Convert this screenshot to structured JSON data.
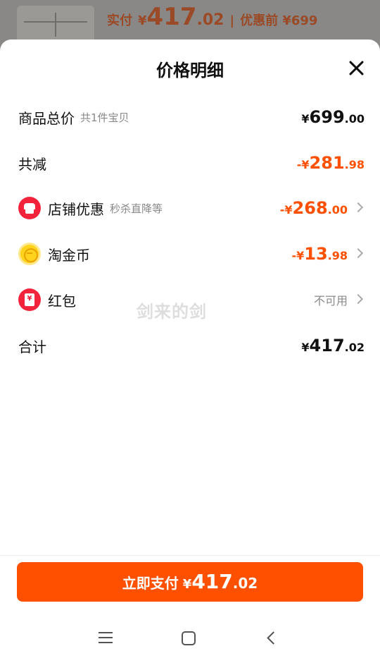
{
  "background": {
    "price_label": "实付",
    "yen": "¥",
    "price_int": "417",
    "price_dec": ".02",
    "separator": "|",
    "original_label": "优惠前 ¥699"
  },
  "sheet": {
    "title": "价格明细",
    "close_icon": "close-icon"
  },
  "rows": {
    "total": {
      "label": "商品总价",
      "sub": "共1件宝贝",
      "yen": "¥",
      "int": "699",
      "dec": ".00"
    },
    "reduce": {
      "label": "共减",
      "yen": "-¥",
      "int": "281",
      "dec": ".98"
    },
    "shop": {
      "label": "店铺优惠",
      "sub": "秒杀直降等",
      "yen": "-¥",
      "int": "268",
      "dec": ".00",
      "icon": "shop-icon"
    },
    "coin": {
      "label": "淘金币",
      "yen": "-¥",
      "int": "13",
      "dec": ".98",
      "icon": "gold-coin-icon"
    },
    "redpack": {
      "label": "红包",
      "status": "不可用",
      "icon": "red-envelope-icon"
    },
    "sum": {
      "label": "合计",
      "yen": "¥",
      "int": "417",
      "dec": ".02"
    }
  },
  "watermark": "剑来的剑",
  "pay_button": {
    "label": "立即支付",
    "yen": "¥",
    "int": "417",
    "dec": ".02"
  },
  "colors": {
    "accent": "#ff5000",
    "text": "#111111",
    "muted": "#888888"
  }
}
